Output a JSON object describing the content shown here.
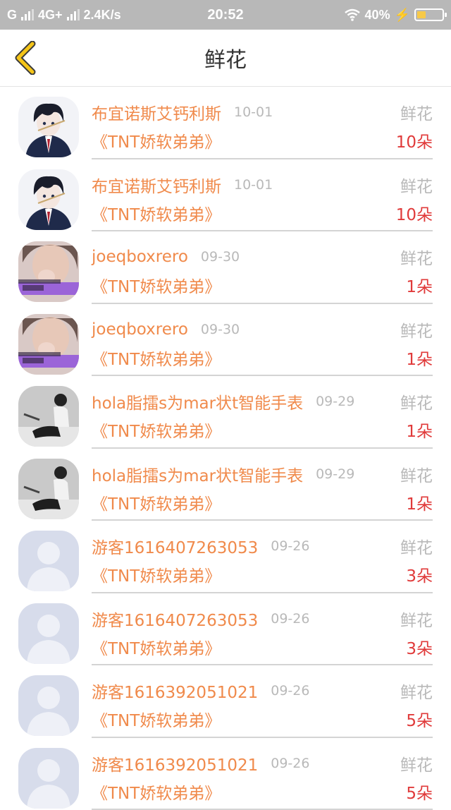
{
  "status_bar": {
    "carrier": "G",
    "network": "4G+",
    "speed": "2.4K/s",
    "time": "20:52",
    "battery": "40%"
  },
  "header": {
    "title": "鲜花",
    "back_icon": "chevron-left-icon",
    "accent_color": "#f0b400"
  },
  "colors": {
    "name": "#f08a4b",
    "meta": "#b9b9b9",
    "count": "#e03a3a"
  },
  "items": [
    {
      "name": "布宜诺斯艾钙利斯",
      "date": "10-01",
      "gift": "鲜花",
      "book": "《TNT娇软弟弟》",
      "count": "10朵",
      "avatar": "anime-avatar"
    },
    {
      "name": "布宜诺斯艾钙利斯",
      "date": "10-01",
      "gift": "鲜花",
      "book": "《TNT娇软弟弟》",
      "count": "10朵",
      "avatar": "anime-avatar"
    },
    {
      "name": "joeqboxrero",
      "date": "09-30",
      "gift": "鲜花",
      "book": "《TNT娇软弟弟》",
      "count": "1朵",
      "avatar": "photo-avatar"
    },
    {
      "name": "joeqboxrero",
      "date": "09-30",
      "gift": "鲜花",
      "book": "《TNT娇软弟弟》",
      "count": "1朵",
      "avatar": "photo-avatar"
    },
    {
      "name": "hola脂擂s为mar状t智能手表",
      "date": "09-29",
      "gift": "鲜花",
      "book": "《TNT娇软弟弟》",
      "count": "1朵",
      "avatar": "bw-photo-avatar"
    },
    {
      "name": "hola脂擂s为mar状t智能手表",
      "date": "09-29",
      "gift": "鲜花",
      "book": "《TNT娇软弟弟》",
      "count": "1朵",
      "avatar": "bw-photo-avatar"
    },
    {
      "name": "游客1616407263053",
      "date": "09-26",
      "gift": "鲜花",
      "book": "《TNT娇软弟弟》",
      "count": "3朵",
      "avatar": "default-avatar"
    },
    {
      "name": "游客1616407263053",
      "date": "09-26",
      "gift": "鲜花",
      "book": "《TNT娇软弟弟》",
      "count": "3朵",
      "avatar": "default-avatar"
    },
    {
      "name": "游客1616392051021",
      "date": "09-26",
      "gift": "鲜花",
      "book": "《TNT娇软弟弟》",
      "count": "5朵",
      "avatar": "default-avatar"
    },
    {
      "name": "游客1616392051021",
      "date": "09-26",
      "gift": "鲜花",
      "book": "《TNT娇软弟弟》",
      "count": "5朵",
      "avatar": "default-avatar"
    }
  ]
}
